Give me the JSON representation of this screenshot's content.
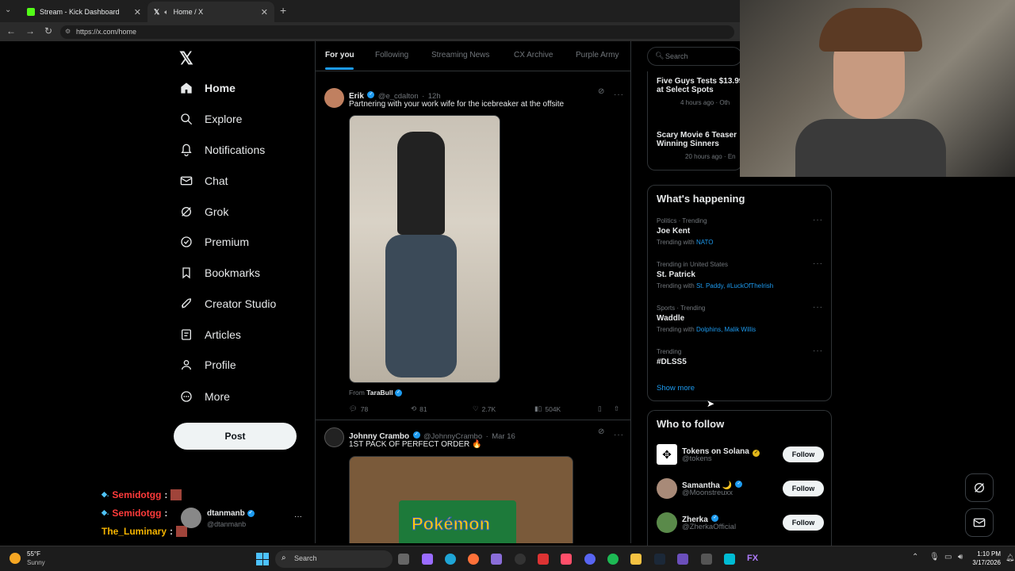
{
  "browser": {
    "tabs": [
      {
        "title": "Stream - Kick Dashboard"
      },
      {
        "title": "Home / X"
      }
    ],
    "url": "https://x.com/home"
  },
  "nav": {
    "items": [
      {
        "label": "Home",
        "icon": "home-icon"
      },
      {
        "label": "Explore",
        "icon": "search-icon"
      },
      {
        "label": "Notifications",
        "icon": "bell-icon"
      },
      {
        "label": "Chat",
        "icon": "mail-icon"
      },
      {
        "label": "Grok",
        "icon": "grok-icon"
      },
      {
        "label": "Premium",
        "icon": "premium-icon"
      },
      {
        "label": "Bookmarks",
        "icon": "bookmark-icon"
      },
      {
        "label": "Creator Studio",
        "icon": "rocket-icon"
      },
      {
        "label": "Articles",
        "icon": "article-icon"
      },
      {
        "label": "Profile",
        "icon": "person-icon"
      },
      {
        "label": "More",
        "icon": "more-icon"
      }
    ],
    "post_label": "Post",
    "account": {
      "name": "dtanmanb",
      "handle": "@dtanmanb"
    }
  },
  "chat_overlay": [
    {
      "user": "Semidotgg",
      "sep": ":"
    },
    {
      "user": "Semidotgg",
      "sep": ":"
    },
    {
      "user": "The_Luminary",
      "sep": ":"
    }
  ],
  "feed": {
    "tabs": [
      "For you",
      "Following",
      "Streaming News",
      "CX Archive",
      "Purple Army"
    ],
    "posts": [
      {
        "name": "Erik",
        "handle": "@e_cdalton",
        "time": "12h",
        "text": "Partnering with your work wife for the icebreaker at the offsite",
        "from_label": "From",
        "from_name": "TaraBull",
        "replies": "78",
        "reposts": "81",
        "likes": "2.7K",
        "views": "504K"
      },
      {
        "name": "Johnny Crambo",
        "handle": "@JohnnyCrambo",
        "time": "Mar 16",
        "text": "1ST PACK OF PERFECT ORDER 🔥",
        "image_text": "Pokémon"
      }
    ]
  },
  "right": {
    "search_placeholder": "Search",
    "news": [
      {
        "title": "Five Guys Tests $13.99",
        "title2": "at Select Spots",
        "meta": "4 hours ago · Oth"
      },
      {
        "title": "Scary Movie 6 Teaser",
        "title2": "Winning Sinners",
        "meta": "20 hours ago · En"
      }
    ],
    "happening_title": "What's happening",
    "trends": [
      {
        "meta": "Politics · Trending",
        "title": "Joe Kent",
        "with_label": "Trending with",
        "with": "NATO"
      },
      {
        "meta": "Trending in United States",
        "title": "St. Patrick",
        "with_label": "Trending with",
        "with": "St. Paddy, #LuckOfTheIrish"
      },
      {
        "meta": "Sports · Trending",
        "title": "Waddle",
        "with_label": "Trending with",
        "with": "Dolphins, Malik Willis"
      },
      {
        "meta": "Trending",
        "title": "#DLSS5",
        "with_label": "",
        "with": ""
      }
    ],
    "show_more": "Show more",
    "who_title": "Who to follow",
    "follow": [
      {
        "name": "Tokens on Solana",
        "handle": "@tokens",
        "button": "Follow"
      },
      {
        "name": "Samantha 🌙",
        "handle": "@Moonstreuxx",
        "button": "Follow"
      },
      {
        "name": "Zherka",
        "handle": "@ZherkaOfficial",
        "button": "Follow"
      }
    ]
  },
  "taskbar": {
    "weather_temp": "55°F",
    "weather_desc": "Sunny",
    "search_label": "Search",
    "time": "1:10 PM",
    "date": "3/17/2026"
  },
  "colors": {
    "accent": "#1d9bf0",
    "chat_red": "#ff3b3b",
    "chat_gold": "#f5b400"
  }
}
